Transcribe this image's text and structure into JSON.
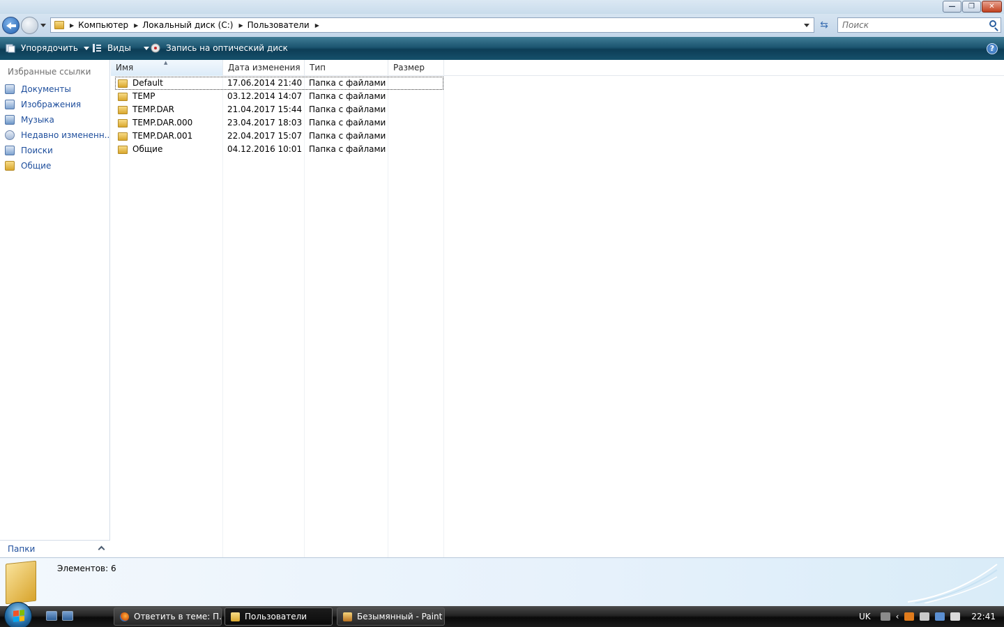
{
  "window": {
    "controls": {
      "minimize": "—",
      "maximize": "❐",
      "close": "✕"
    }
  },
  "address": {
    "breadcrumbs": [
      "Компьютер",
      "Локальный диск (C:)",
      "Пользователи"
    ],
    "search_placeholder": "Поиск"
  },
  "toolbar": {
    "organize_label": "Упорядочить",
    "views_label": "Виды",
    "burn_label": "Запись на оптический диск",
    "help_label": "?"
  },
  "sidebar": {
    "header": "Избранные ссылки",
    "items": [
      {
        "label": "Документы",
        "icon": "documents-icon"
      },
      {
        "label": "Изображения",
        "icon": "pictures-icon"
      },
      {
        "label": "Музыка",
        "icon": "music-icon"
      },
      {
        "label": "Недавно измененн...",
        "icon": "recent-icon"
      },
      {
        "label": "Поиски",
        "icon": "searches-icon"
      },
      {
        "label": "Общие",
        "icon": "folder-icon"
      }
    ],
    "folders_label": "Папки"
  },
  "list": {
    "columns": [
      "Имя",
      "Дата изменения",
      "Тип",
      "Размер"
    ],
    "sorted_column": "Имя",
    "rows": [
      {
        "name": "Default",
        "date": "17.06.2014 21:40",
        "type": "Папка с файлами",
        "size": ""
      },
      {
        "name": "TEMP",
        "date": "03.12.2014 14:07",
        "type": "Папка с файлами",
        "size": ""
      },
      {
        "name": "TEMP.DAR",
        "date": "21.04.2017 15:44",
        "type": "Папка с файлами",
        "size": ""
      },
      {
        "name": "TEMP.DAR.000",
        "date": "23.04.2017 18:03",
        "type": "Папка с файлами",
        "size": ""
      },
      {
        "name": "TEMP.DAR.001",
        "date": "22.04.2017 15:07",
        "type": "Папка с файлами",
        "size": ""
      },
      {
        "name": "Общие",
        "date": "04.12.2016 10:01",
        "type": "Папка с файлами",
        "size": ""
      }
    ]
  },
  "details": {
    "count_text": "Элементов: 6"
  },
  "taskbar": {
    "buttons": [
      {
        "label": "Ответить в теме: П...",
        "icon": "firefox-icon"
      },
      {
        "label": "Пользователи",
        "icon": "folder-icon"
      },
      {
        "label": "Безымянный - Paint",
        "icon": "paint-icon"
      }
    ],
    "language": "UK",
    "time": "22:41"
  },
  "colors": {
    "toolbar_dark": "#0d3d56",
    "link_blue": "#1e4e9c",
    "folder_yellow": "#d9a72e"
  }
}
